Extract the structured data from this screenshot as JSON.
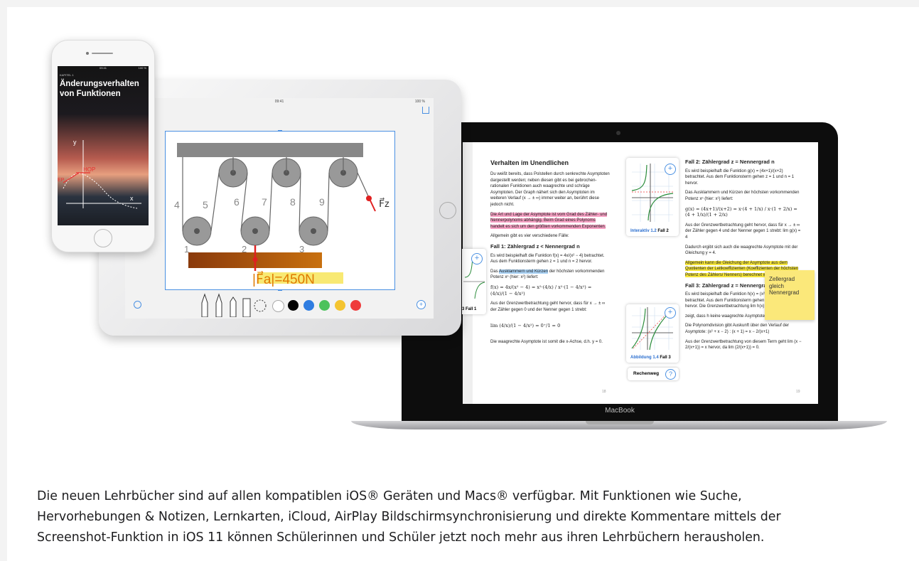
{
  "caption": {
    "line1": "Die neuen Lehrbücher sind auf allen kompatiblen iOS® Geräten und Macs®  verfügbar. Mit Funktionen wie Suche,",
    "line2": "Hervorhebungen & Notizen, Lernkarten, iCloud, AirPlay Bildschirmsynchronisierung und direkte Kommentare mittels der",
    "line3": "Screenshot-Funktion in iOS 11 können Schülerinnen und Schüler jetzt noch mehr aus ihren Lehrbüchern herausholen."
  },
  "macbook": {
    "label": "MacBook",
    "left_page": {
      "title": "Verhalten im Unendlichen",
      "p1": "Du weißt bereits, dass Polstellen durch senkrechte Asymptoten dargestellt werden; neben diesen gibt es bei gebrochen-rationalen Funktionen auch waagrechte und schräge Asymptoten. Der Graph nähert sich den Asymptoten im weiteren Verlauf (x → ± ∞) immer weiter an, berührt diese jedoch nicht.",
      "p2_highlight": "Die Art und Lage der Asymptote ist vom Grad des Zähler- und Nennerpolynoms abhängig. Beim Grad eines Polynoms handelt es sich um den größten vorkommenden Exponenten.",
      "p3": "Allgemein gibt es vier verschiedene Fälle:",
      "case1": "Fall 1: Zählergrad z < Nennergrad n",
      "p4": "Es wird beispielhaft die Funktion f(x) = 4x/(x² − 4) betrachtet. Aus dem Funktionsterm gehen z = 1 und n = 2 hervor.",
      "p5_pre": "Das ",
      "p5_highlight": "Ausklammern und Kürzen",
      "p5_post": " der höchsten vorkommenden Potenz xⁿ (hier: x²) liefert:",
      "formula1": "f(x) = 4x/(x² − 4) = x²·(4/x) / x²·(1 − 4/x²) = (4/x)/(1 − 4/x²)",
      "p6": "Aus der Grenzwertbetrachtung geht hervor, dass für x → ± ∞ der Zähler gegen 0 und der Nenner gegen 1 strebt:",
      "formula2": "lim (4/x)/(1 − 4/x²) = 0⁺/1 = 0",
      "p7": "Die waagrechte Asymptote ist somit die x-Achse, d.h. y = 0.",
      "page_number": "18"
    },
    "right_page": {
      "case2": "Fall 2: Zählergrad z = Nennergrad n",
      "p1": "Es wird beispielhaft die Funktion g(x) = (4x+1)/(x+2) betrachtet. Aus dem Funktionsterm gehen z = 1 und n = 1 hervor.",
      "p2": "Das Ausklammern und Kürzen der höchsten vorkommenden Potenz xⁿ (hier: x¹) liefert:",
      "formula1": "g(x) = (4x+1)/(x+2) = x·(4 + 1/x) / x·(1 + 2/x) = (4 + 1/x)/(1 + 2/x)",
      "p3": "Aus der Grenzwertbetrachtung geht hervor, dass für x → ± ∞ der Zähler gegen 4 und der Nenner gegen 1 strebt:  lim g(x) = 4",
      "p4": "Dadurch ergibt sich auch die waagrechte Asymptote mit der Gleichung y = 4.",
      "p5_highlight": "Allgemein kann die Gleichung der Asymptote aus dem Quotienten der Leitkoeffizienten (Koeffizienten der höchsten Potenz des Zählers/ Nenners) berechnet werden.",
      "case3": "Fall 3: Zählergrad z = Nennergrad n + 1",
      "p6": "Es wird beispielhaft die Funktion h(x) = (x²+x−2)/(x+1) betrachtet. Aus dem Funktionsterm gehen z = 2 und n = 1 hervor. Die Grenzwertbetrachtung  lim h(x) = + ∞",
      "p7": "zeigt, dass h keine waagrechte Asymptote hat.",
      "p8": "Die Polynomdivision gibt Auskunft über den Verlauf der Asymptote: (x² + x − 2) : (x + 1) = x − 2/(x+1)",
      "p9": "Aus der Grenzwertbetrachtung von diesem Term geht  lim (x − 2/(x+1)) = x hervor, da  lim (2/(x+1)) = 0.",
      "page_number": "19"
    },
    "card_interaktiv": {
      "label_blue": "Interaktiv 1.2",
      "label": "Fall 2"
    },
    "card_abbildung": {
      "label_blue": "Abbildung 1.4",
      "label": "Fall 3"
    },
    "card_left": {
      "label": "3 Fall 1"
    },
    "sticky_note": "Zellergrad gleich Nennergrad",
    "rechenweg": {
      "label": "Rechenweg",
      "icon_text": "?"
    },
    "plus": "+"
  },
  "ipad": {
    "time": "09:41",
    "battery": "100 %",
    "pulley_numbers": [
      "4",
      "5",
      "6",
      "7",
      "8",
      "9"
    ],
    "bottom_numbers": [
      "1",
      "2",
      "3"
    ],
    "force_label": "F⃗z",
    "handwriting": "|F⃗a|=450N",
    "colors": [
      "#ffffff",
      "#000000",
      "#2f7de1",
      "#4cc25c",
      "#f4c430",
      "#ef3b3b"
    ],
    "plus": "+"
  },
  "iphone": {
    "time": "09:41",
    "battery": "100 %",
    "chapter": "KAPITEL 1",
    "title": "Änderungsverhalten von Funktionen",
    "labels": {
      "y": "y",
      "x": "x",
      "hop": "HOP",
      "ep": "EP"
    }
  }
}
